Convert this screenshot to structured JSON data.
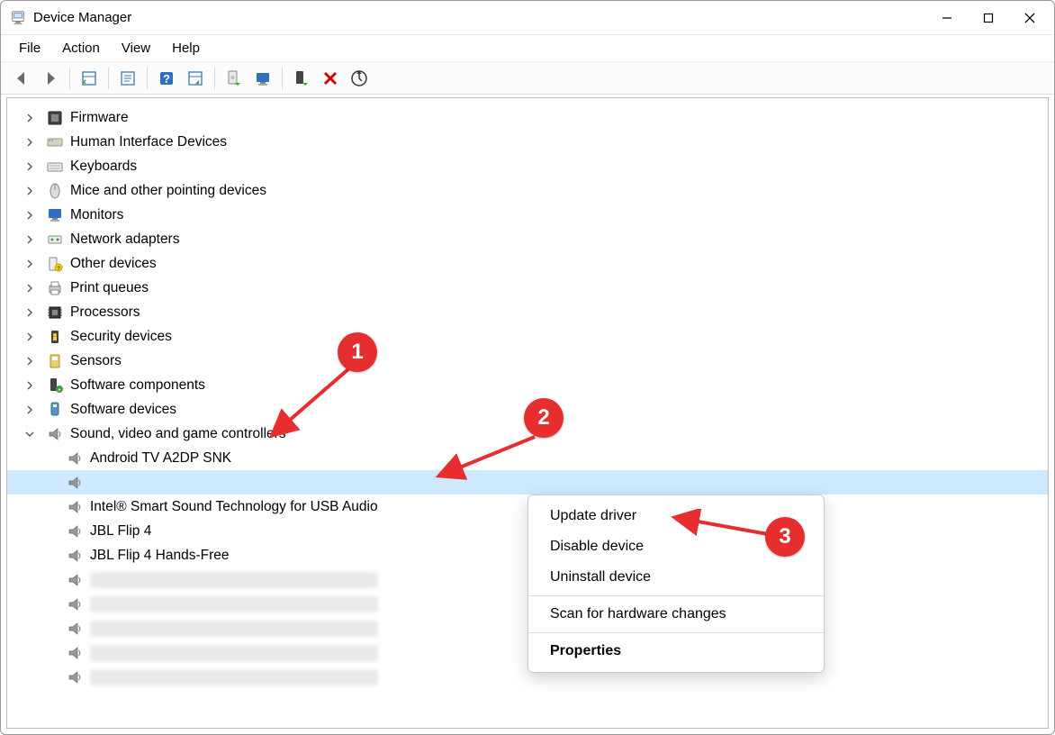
{
  "window": {
    "title": "Device Manager"
  },
  "menubar": {
    "items": [
      "File",
      "Action",
      "View",
      "Help"
    ]
  },
  "toolbar": {
    "back": "back-icon",
    "forward": "forward-icon",
    "show_hidden": "show-hidden-icon",
    "properties": "properties-icon",
    "help": "help-icon",
    "refresh": "refresh-icon",
    "update_driver": "update-driver-icon",
    "scan": "monitor-icon",
    "enable": "enable-icon",
    "disable": "disable-icon",
    "uninstall": "uninstall-icon"
  },
  "tree": {
    "collapsed": [
      {
        "label": "Firmware",
        "icon": "firmware"
      },
      {
        "label": "Human Interface Devices",
        "icon": "hid"
      },
      {
        "label": "Keyboards",
        "icon": "keyboard"
      },
      {
        "label": "Mice and other pointing devices",
        "icon": "mouse"
      },
      {
        "label": "Monitors",
        "icon": "monitor"
      },
      {
        "label": "Network adapters",
        "icon": "network"
      },
      {
        "label": "Other devices",
        "icon": "other"
      },
      {
        "label": "Print queues",
        "icon": "printer"
      },
      {
        "label": "Processors",
        "icon": "cpu"
      },
      {
        "label": "Security devices",
        "icon": "security"
      },
      {
        "label": "Sensors",
        "icon": "sensor"
      },
      {
        "label": "Software components",
        "icon": "software"
      },
      {
        "label": "Software devices",
        "icon": "software_dev"
      }
    ],
    "expanded": {
      "label": "Sound, video and game controllers",
      "icon": "speaker",
      "children": [
        {
          "label": "Android TV A2DP SNK",
          "icon": "speaker",
          "blurred": false
        },
        {
          "label": "",
          "icon": "speaker",
          "selected": true,
          "blurred": false
        },
        {
          "label": "Intel® Smart Sound Technology for USB Audio",
          "icon": "speaker",
          "blurred": false
        },
        {
          "label": "JBL Flip 4",
          "icon": "speaker",
          "blurred": false
        },
        {
          "label": "JBL Flip 4 Hands-Free",
          "icon": "speaker",
          "blurred": false
        },
        {
          "label": "hidden device name placeholder one",
          "icon": "speaker",
          "blurred": true
        },
        {
          "label": "hidden device name placeholder two",
          "icon": "speaker",
          "blurred": true
        },
        {
          "label": "hidden device name placeholder three",
          "icon": "speaker",
          "blurred": true
        },
        {
          "label": "hidden device name placeholder four",
          "icon": "speaker",
          "blurred": true
        },
        {
          "label": "hidden device name placeholder five",
          "icon": "speaker",
          "blurred": true
        }
      ]
    }
  },
  "context_menu": {
    "items": [
      {
        "label": "Update driver"
      },
      {
        "label": "Disable device"
      },
      {
        "label": "Uninstall device"
      },
      {
        "sep": true
      },
      {
        "label": "Scan for hardware changes"
      },
      {
        "sep": true
      },
      {
        "label": "Properties",
        "bold": true
      }
    ]
  },
  "annotations": {
    "b1": "1",
    "b2": "2",
    "b3": "3"
  }
}
